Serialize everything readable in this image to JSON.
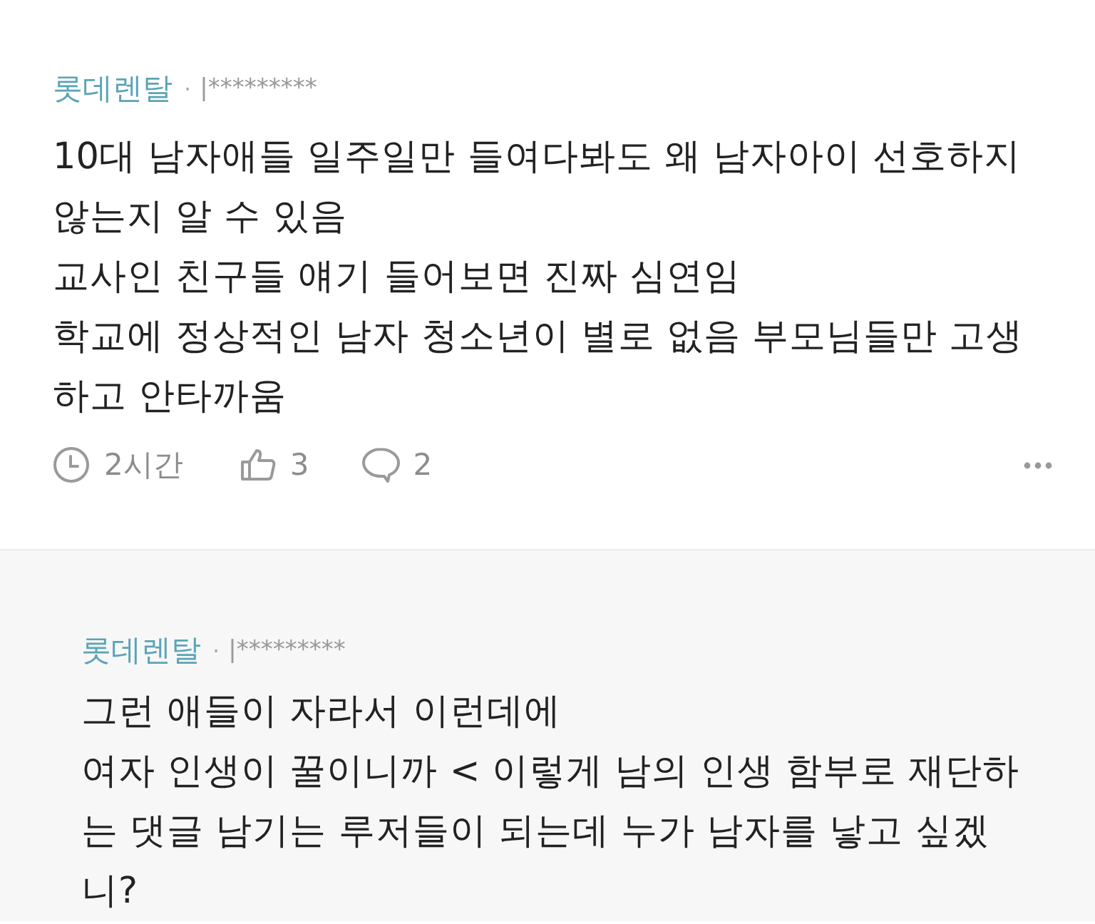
{
  "comments": [
    {
      "kind": "comment",
      "author": "롯데렌탈",
      "separator": "·",
      "user_id": "|*********",
      "lines": [
        "10대 남자애들 일주일만 들여다봐도 왜 남자아이 선호하지",
        "않는지 알 수 있음",
        "교사인 친구들 얘기 들어보면 진짜 심연임",
        "학교에 정상적인 남자 청소년이 별로 없음 부모님들만 고생",
        "하고 안타까움"
      ],
      "time": "2시간",
      "likes": "3",
      "replies": "2"
    },
    {
      "kind": "reply",
      "author": "롯데렌탈",
      "separator": "·",
      "user_id": "|*********",
      "lines": [
        "그런 애들이 자라서 이런데에",
        "여자 인생이 꿀이니까 < 이렇게 남의 인생 함부로 재단하",
        "는 댓글 남기는 루저들이 되는데 누가 남자를 낳고 싶겠",
        "니?"
      ]
    }
  ]
}
